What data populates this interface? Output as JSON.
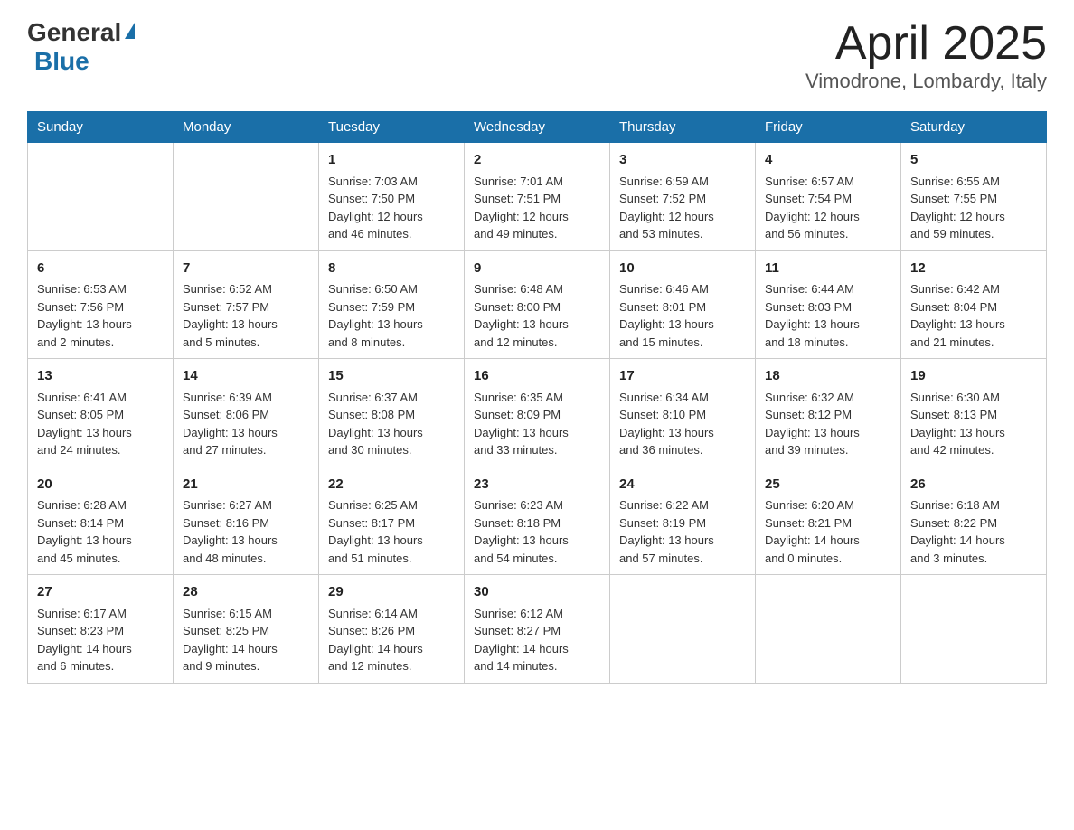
{
  "header": {
    "logo_general": "General",
    "logo_blue": "Blue",
    "title": "April 2025",
    "subtitle": "Vimodrone, Lombardy, Italy"
  },
  "days_of_week": [
    "Sunday",
    "Monday",
    "Tuesday",
    "Wednesday",
    "Thursday",
    "Friday",
    "Saturday"
  ],
  "weeks": [
    [
      {
        "day": "",
        "info": ""
      },
      {
        "day": "",
        "info": ""
      },
      {
        "day": "1",
        "info": "Sunrise: 7:03 AM\nSunset: 7:50 PM\nDaylight: 12 hours\nand 46 minutes."
      },
      {
        "day": "2",
        "info": "Sunrise: 7:01 AM\nSunset: 7:51 PM\nDaylight: 12 hours\nand 49 minutes."
      },
      {
        "day": "3",
        "info": "Sunrise: 6:59 AM\nSunset: 7:52 PM\nDaylight: 12 hours\nand 53 minutes."
      },
      {
        "day": "4",
        "info": "Sunrise: 6:57 AM\nSunset: 7:54 PM\nDaylight: 12 hours\nand 56 minutes."
      },
      {
        "day": "5",
        "info": "Sunrise: 6:55 AM\nSunset: 7:55 PM\nDaylight: 12 hours\nand 59 minutes."
      }
    ],
    [
      {
        "day": "6",
        "info": "Sunrise: 6:53 AM\nSunset: 7:56 PM\nDaylight: 13 hours\nand 2 minutes."
      },
      {
        "day": "7",
        "info": "Sunrise: 6:52 AM\nSunset: 7:57 PM\nDaylight: 13 hours\nand 5 minutes."
      },
      {
        "day": "8",
        "info": "Sunrise: 6:50 AM\nSunset: 7:59 PM\nDaylight: 13 hours\nand 8 minutes."
      },
      {
        "day": "9",
        "info": "Sunrise: 6:48 AM\nSunset: 8:00 PM\nDaylight: 13 hours\nand 12 minutes."
      },
      {
        "day": "10",
        "info": "Sunrise: 6:46 AM\nSunset: 8:01 PM\nDaylight: 13 hours\nand 15 minutes."
      },
      {
        "day": "11",
        "info": "Sunrise: 6:44 AM\nSunset: 8:03 PM\nDaylight: 13 hours\nand 18 minutes."
      },
      {
        "day": "12",
        "info": "Sunrise: 6:42 AM\nSunset: 8:04 PM\nDaylight: 13 hours\nand 21 minutes."
      }
    ],
    [
      {
        "day": "13",
        "info": "Sunrise: 6:41 AM\nSunset: 8:05 PM\nDaylight: 13 hours\nand 24 minutes."
      },
      {
        "day": "14",
        "info": "Sunrise: 6:39 AM\nSunset: 8:06 PM\nDaylight: 13 hours\nand 27 minutes."
      },
      {
        "day": "15",
        "info": "Sunrise: 6:37 AM\nSunset: 8:08 PM\nDaylight: 13 hours\nand 30 minutes."
      },
      {
        "day": "16",
        "info": "Sunrise: 6:35 AM\nSunset: 8:09 PM\nDaylight: 13 hours\nand 33 minutes."
      },
      {
        "day": "17",
        "info": "Sunrise: 6:34 AM\nSunset: 8:10 PM\nDaylight: 13 hours\nand 36 minutes."
      },
      {
        "day": "18",
        "info": "Sunrise: 6:32 AM\nSunset: 8:12 PM\nDaylight: 13 hours\nand 39 minutes."
      },
      {
        "day": "19",
        "info": "Sunrise: 6:30 AM\nSunset: 8:13 PM\nDaylight: 13 hours\nand 42 minutes."
      }
    ],
    [
      {
        "day": "20",
        "info": "Sunrise: 6:28 AM\nSunset: 8:14 PM\nDaylight: 13 hours\nand 45 minutes."
      },
      {
        "day": "21",
        "info": "Sunrise: 6:27 AM\nSunset: 8:16 PM\nDaylight: 13 hours\nand 48 minutes."
      },
      {
        "day": "22",
        "info": "Sunrise: 6:25 AM\nSunset: 8:17 PM\nDaylight: 13 hours\nand 51 minutes."
      },
      {
        "day": "23",
        "info": "Sunrise: 6:23 AM\nSunset: 8:18 PM\nDaylight: 13 hours\nand 54 minutes."
      },
      {
        "day": "24",
        "info": "Sunrise: 6:22 AM\nSunset: 8:19 PM\nDaylight: 13 hours\nand 57 minutes."
      },
      {
        "day": "25",
        "info": "Sunrise: 6:20 AM\nSunset: 8:21 PM\nDaylight: 14 hours\nand 0 minutes."
      },
      {
        "day": "26",
        "info": "Sunrise: 6:18 AM\nSunset: 8:22 PM\nDaylight: 14 hours\nand 3 minutes."
      }
    ],
    [
      {
        "day": "27",
        "info": "Sunrise: 6:17 AM\nSunset: 8:23 PM\nDaylight: 14 hours\nand 6 minutes."
      },
      {
        "day": "28",
        "info": "Sunrise: 6:15 AM\nSunset: 8:25 PM\nDaylight: 14 hours\nand 9 minutes."
      },
      {
        "day": "29",
        "info": "Sunrise: 6:14 AM\nSunset: 8:26 PM\nDaylight: 14 hours\nand 12 minutes."
      },
      {
        "day": "30",
        "info": "Sunrise: 6:12 AM\nSunset: 8:27 PM\nDaylight: 14 hours\nand 14 minutes."
      },
      {
        "day": "",
        "info": ""
      },
      {
        "day": "",
        "info": ""
      },
      {
        "day": "",
        "info": ""
      }
    ]
  ]
}
